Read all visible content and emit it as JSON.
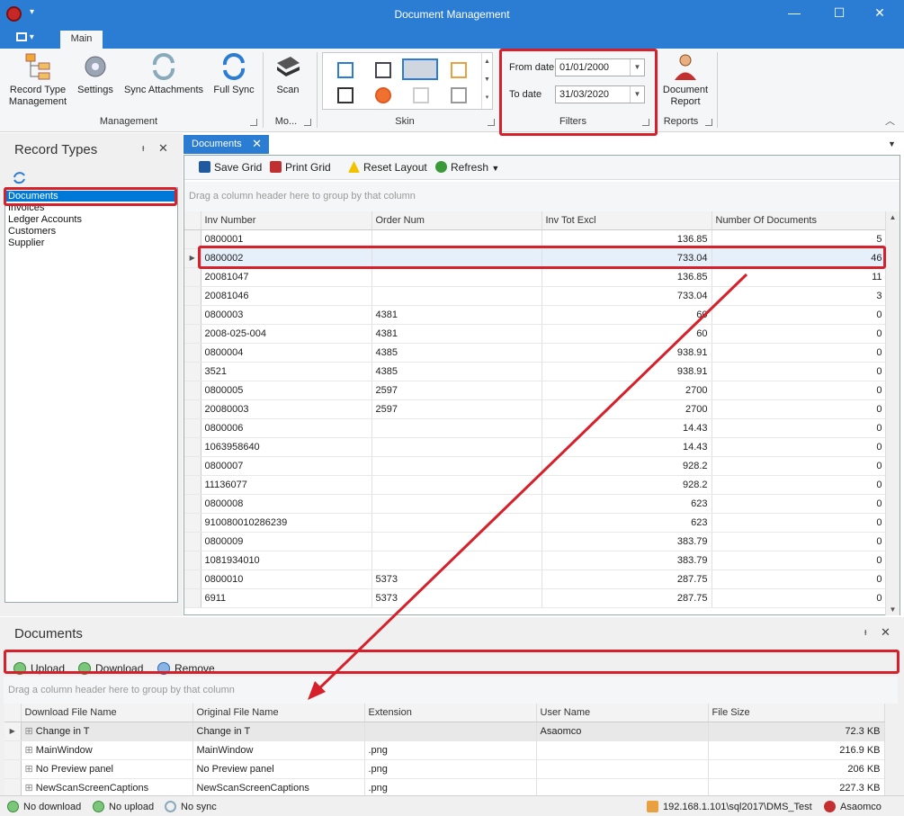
{
  "window": {
    "title": "Document Management"
  },
  "tabs": {
    "file_glyph": "▾",
    "main": "Main"
  },
  "ribbon": {
    "record_type": "Record Type Management",
    "settings": "Settings",
    "sync_attachments": "Sync Attachments",
    "full_sync": "Full Sync",
    "management_group": "Management",
    "scan": "Scan",
    "mo_group": "Mo...",
    "skin_group": "Skin",
    "from_label": "From date",
    "from_value": "01/01/2000",
    "to_label": "To date",
    "to_value": "31/03/2020",
    "filters_group": "Filters",
    "document_report": "Document Report",
    "reports_group": "Reports"
  },
  "left_panel": {
    "title": "Record Types",
    "items": [
      "Documents",
      "Invoices",
      "Ledger Accounts",
      "Customers",
      "Supplier"
    ]
  },
  "main": {
    "tab_label": "Documents",
    "toolbar": {
      "save": "Save Grid",
      "print": "Print Grid",
      "reset": "Reset Layout",
      "refresh": "Refresh"
    },
    "group_hint": "Drag a column header here to group by that column",
    "columns": [
      "Inv Number",
      "Order Num",
      "Inv Tot Excl",
      "Number Of Documents"
    ],
    "rows": [
      [
        "0800001",
        "",
        "136.85",
        "5"
      ],
      [
        "0800002",
        "",
        "733.04",
        "46"
      ],
      [
        "20081047",
        "",
        "136.85",
        "11"
      ],
      [
        "20081046",
        "",
        "733.04",
        "3"
      ],
      [
        "0800003",
        "4381",
        "60",
        "0"
      ],
      [
        "2008-025-004",
        "4381",
        "60",
        "0"
      ],
      [
        "0800004",
        "4385",
        "938.91",
        "0"
      ],
      [
        "3521",
        "4385",
        "938.91",
        "0"
      ],
      [
        "0800005",
        "2597",
        "2700",
        "0"
      ],
      [
        "20080003",
        "2597",
        "2700",
        "0"
      ],
      [
        "0800006",
        "",
        "14.43",
        "0"
      ],
      [
        "1063958640",
        "",
        "14.43",
        "0"
      ],
      [
        "0800007",
        "",
        "928.2",
        "0"
      ],
      [
        "11136077",
        "",
        "928.2",
        "0"
      ],
      [
        "0800008",
        "",
        "623",
        "0"
      ],
      [
        "910080010286239",
        "",
        "623",
        "0"
      ],
      [
        "0800009",
        "",
        "383.79",
        "0"
      ],
      [
        "1081934010",
        "",
        "383.79",
        "0"
      ],
      [
        "0800010",
        "5373",
        "287.75",
        "0"
      ],
      [
        "6911",
        "5373",
        "287.75",
        "0"
      ]
    ]
  },
  "bottom_panel": {
    "title": "Documents",
    "toolbar": {
      "upload": "Upload",
      "download": "Download",
      "remove": "Remove"
    },
    "group_hint": "Drag a column header here to group by that column",
    "columns": [
      "Download File Name",
      "Original File Name",
      "Extension",
      "User Name",
      "File Size"
    ],
    "rows": [
      [
        "Change in T",
        "Change in T",
        "",
        "Asaomco",
        "72.3 KB"
      ],
      [
        "MainWindow",
        "MainWindow",
        ".png",
        "",
        "216.9 KB"
      ],
      [
        "No Preview panel",
        "No Preview panel",
        ".png",
        "",
        "206 KB"
      ],
      [
        "NewScanScreenCaptions",
        "NewScanScreenCaptions",
        ".png",
        "",
        "227.3 KB"
      ]
    ]
  },
  "status": {
    "no_download": "No download",
    "no_upload": "No upload",
    "no_sync": "No sync",
    "server": "192.168.1.101\\sql2017\\DMS_Test",
    "user": "Asaomco"
  },
  "colors": {
    "accent": "#2b7cd3",
    "highlight": "#d6202b",
    "selection": "#0078d7"
  }
}
